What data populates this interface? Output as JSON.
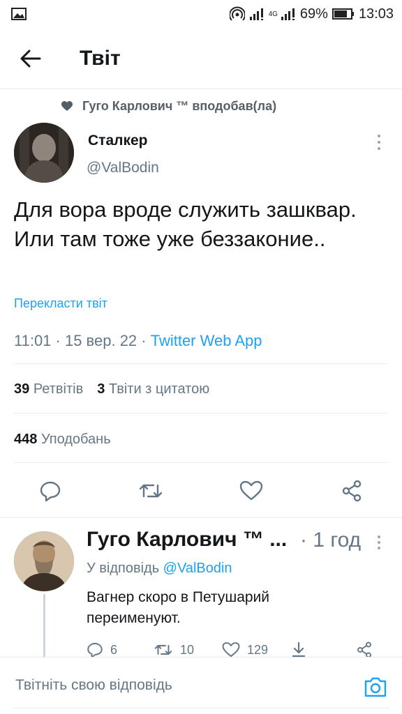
{
  "status_bar": {
    "network": "4G",
    "battery": "69%",
    "time": "13:03"
  },
  "header": {
    "title": "Твіт"
  },
  "tweet": {
    "social_context": "Гуго Карлович ™ вподобав(ла)",
    "author_name": "Сталкер",
    "author_handle": "@ValBodin",
    "text": "Для вора вроде служить зашквар. Или там тоже уже беззаконие..",
    "translate_label": "Перекласти твіт",
    "timestamp": "11:01 · 15 вер. 22 · ",
    "source": "Twitter Web App",
    "retweets_count": "39",
    "retweets_label": "Ретвітів",
    "quotes_count": "3",
    "quotes_label": "Твіти з цитатою",
    "likes_count": "448",
    "likes_label": "Уподобань"
  },
  "reply": {
    "author_name": "Гуго Карлович ™ ...",
    "time": "· 1 год",
    "reply_prefix": "У відповідь ",
    "reply_to": "@ValBodin",
    "text": "Вагнер скоро в Петушарий переименуют.",
    "replies": "6",
    "retweets": "10",
    "likes": "129"
  },
  "compose": {
    "placeholder": "Твітніть свою відповідь"
  },
  "colors": {
    "accent": "#1da1f2",
    "secondary_text": "#657786",
    "primary_text": "#14171a",
    "divider": "#e6ecf0"
  }
}
